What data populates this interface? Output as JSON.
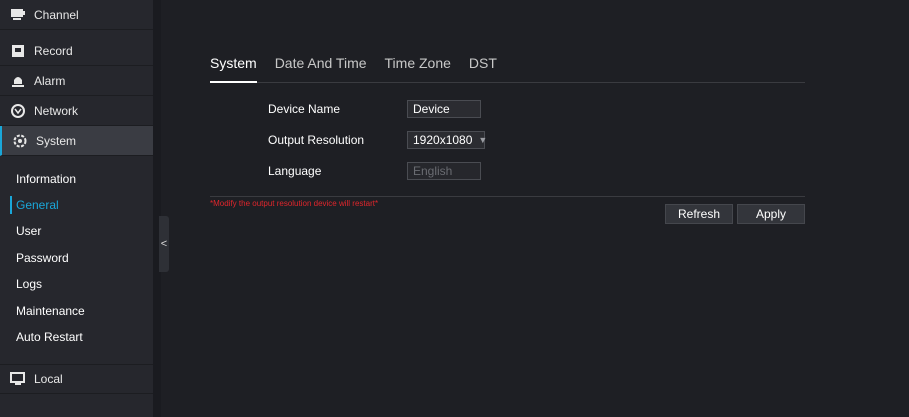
{
  "sidebar": {
    "menu": [
      {
        "label": "Channel",
        "icon": "channel-icon"
      },
      {
        "label": "Record",
        "icon": "record-icon"
      },
      {
        "label": "Alarm",
        "icon": "alarm-icon"
      },
      {
        "label": "Network",
        "icon": "network-icon"
      },
      {
        "label": "System",
        "icon": "system-icon"
      },
      {
        "label": "Local",
        "icon": "local-icon"
      }
    ],
    "submenu": [
      "Information",
      "General",
      "User",
      "Password",
      "Logs",
      "Maintenance",
      "Auto Restart"
    ],
    "active_menu": "System",
    "active_submenu": "General",
    "collapse_glyph": "<"
  },
  "tabs": [
    "System",
    "Date And Time",
    "Time Zone",
    "DST"
  ],
  "active_tab": "System",
  "form": {
    "device_name_label": "Device Name",
    "device_name_value": "Device",
    "output_resolution_label": "Output Resolution",
    "output_resolution_value": "1920x1080",
    "language_label": "Language",
    "language_value": "English"
  },
  "warning": "*Modify the output resolution device will restart*",
  "buttons": {
    "refresh": "Refresh",
    "apply": "Apply"
  },
  "colors": {
    "accent": "#1aa7d9",
    "warning": "#e0262c",
    "background": "#1e1f24",
    "sidebar": "#26272d"
  }
}
